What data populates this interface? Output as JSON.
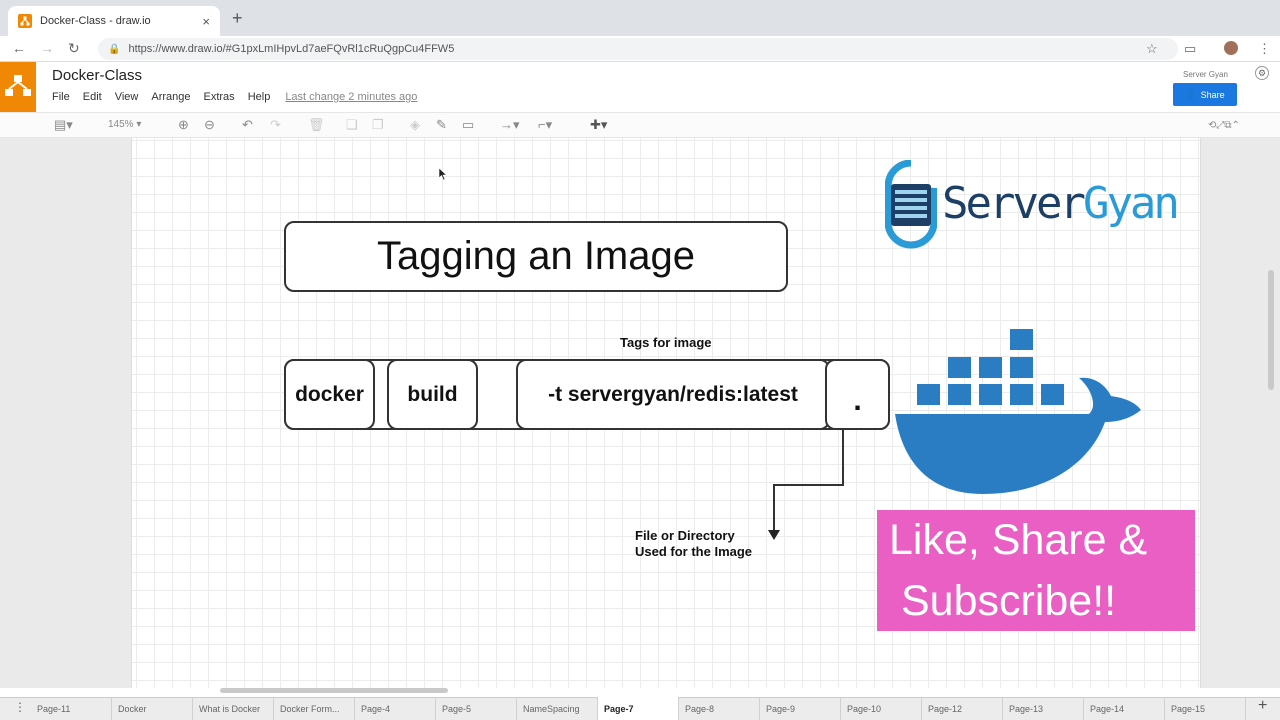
{
  "browser": {
    "tab_title": "Docker-Class - draw.io",
    "tab_close": "×",
    "new_tab": "+",
    "url": "https://www.draw.io/#G1pxLmIHpvLd7aeFQvRl1cRuQgpCu4FFW5"
  },
  "app": {
    "doc_title": "Docker-Class",
    "menu": [
      "File",
      "Edit",
      "View",
      "Arrange",
      "Extras",
      "Help"
    ],
    "last_change": "Last change 2 minutes ago",
    "user_name": "Server Gyan",
    "share_label": "Share",
    "zoom": "145%"
  },
  "diagram": {
    "title": "Tagging an Image",
    "cmd_docker": "docker",
    "cmd_build": "build",
    "cmd_tag": "-t servergyan/redis:latest",
    "cmd_dot": ".",
    "tags_label": "Tags for image",
    "file_label_1": "File or Directory",
    "file_label_2": "Used for the Image"
  },
  "branding": {
    "server": "Server",
    "gyan": "Gyan",
    "promo_line1": "Like, Share &",
    "promo_line2": "Subscribe!!",
    "promo_color": "#e95fc3",
    "docker_color": "#2b7dc3"
  },
  "pages": [
    "Page-11",
    "Docker",
    "What is Docker",
    "Docker Form...",
    "Page-4",
    "Page-5",
    "NameSpacing",
    "Page-7",
    "Page-8",
    "Page-9",
    "Page-10",
    "Page-12",
    "Page-13",
    "Page-14",
    "Page-15"
  ],
  "active_page": "Page-7"
}
